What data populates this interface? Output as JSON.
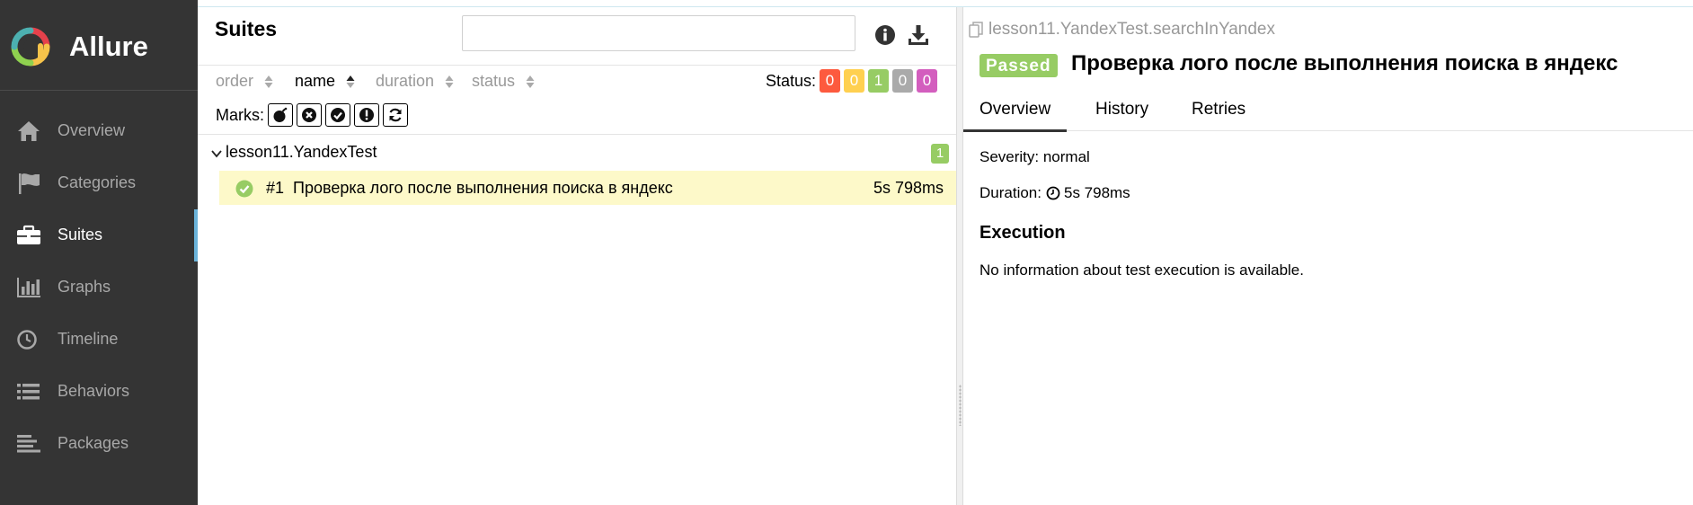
{
  "sidebar": {
    "brand": "Allure",
    "items": [
      {
        "label": "Overview",
        "icon": "home-icon"
      },
      {
        "label": "Categories",
        "icon": "flag-icon"
      },
      {
        "label": "Suites",
        "icon": "briefcase-icon",
        "active": true
      },
      {
        "label": "Graphs",
        "icon": "bar-chart-icon"
      },
      {
        "label": "Timeline",
        "icon": "clock-icon"
      },
      {
        "label": "Behaviors",
        "icon": "list-icon"
      },
      {
        "label": "Packages",
        "icon": "align-left-icon"
      }
    ]
  },
  "suites": {
    "title": "Suites",
    "search": {
      "value": "",
      "placeholder": ""
    },
    "sort": {
      "order": "order",
      "name": "name",
      "duration": "duration",
      "status": "status"
    },
    "status_label": "Status:",
    "status_counts": [
      {
        "name": "failed",
        "count": "0",
        "color": "#fd5a3e"
      },
      {
        "name": "broken",
        "count": "0",
        "color": "#ffd050"
      },
      {
        "name": "passed",
        "count": "1",
        "color": "#97cc64"
      },
      {
        "name": "skipped",
        "count": "0",
        "color": "#aaaaaa"
      },
      {
        "name": "unknown",
        "count": "0",
        "color": "#d35ebe"
      }
    ],
    "marks_label": "Marks:",
    "group": {
      "name": "lesson11.YandexTest",
      "count": "1"
    },
    "test": {
      "number": "#1",
      "name": "Проверка лого после выполнения поиска в яндекс",
      "duration": "5s 798ms"
    }
  },
  "detail": {
    "path": "lesson11.YandexTest.searchInYandex",
    "status": "Passed",
    "title": "Проверка лого после выполнения поиска в яндекс",
    "tabs": [
      "Overview",
      "History",
      "Retries"
    ],
    "severity": "Severity: normal",
    "duration_label": "Duration:",
    "duration": "5s 798ms",
    "execution_title": "Execution",
    "execution_text": "No information about test execution is available."
  },
  "colors": {
    "sidebar_bg": "#343434",
    "active_indicator": "#6bb3d9",
    "passed": "#97cc64",
    "selected_row": "#fdf9c9"
  }
}
